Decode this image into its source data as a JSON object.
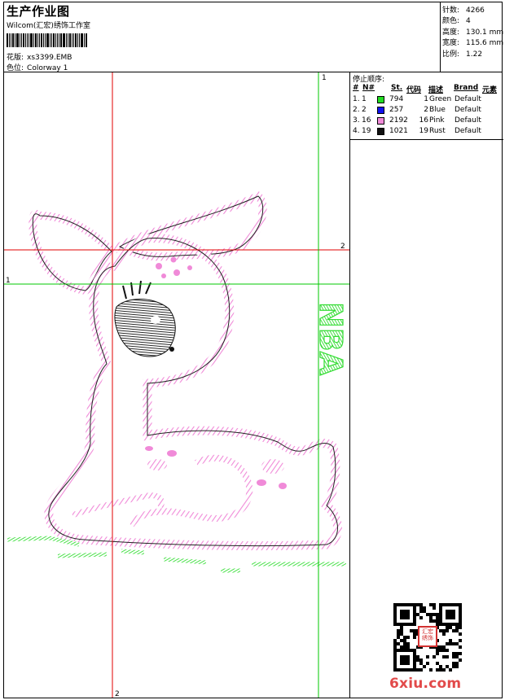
{
  "header": {
    "title": "生产作业图",
    "studio": "Wilcom(汇宏)绣饰工作室",
    "design_label": "花版:",
    "design_value": "xs3399.EMB",
    "colorway_label": "色位:",
    "colorway_value": "Colorway 1"
  },
  "stats": [
    {
      "label": "针数:",
      "value": "4266"
    },
    {
      "label": "颜色:",
      "value": "4"
    },
    {
      "label": "高度:",
      "value": "130.1 mm"
    },
    {
      "label": "宽度:",
      "value": "115.6 mm"
    },
    {
      "label": "比例:",
      "value": "1.22"
    }
  ],
  "stop_sequence": {
    "title": "停止顺序:",
    "columns": [
      "#",
      "N#",
      "St.",
      "代码",
      "描述",
      "Brand",
      "元素"
    ],
    "rows": [
      {
        "index": "1.",
        "needle": "1",
        "stitches": "794",
        "code": "1",
        "description": "Green",
        "brand": "Default",
        "color": "#22dd22"
      },
      {
        "index": "2.",
        "needle": "2",
        "stitches": "257",
        "code": "2",
        "description": "Blue",
        "brand": "Default",
        "color": "#1010ee"
      },
      {
        "index": "3.",
        "needle": "16",
        "stitches": "2192",
        "code": "16",
        "description": "Pink",
        "brand": "Default",
        "color": "#f08ad8"
      },
      {
        "index": "4.",
        "needle": "19",
        "stitches": "1021",
        "code": "19",
        "description": "Rust",
        "brand": "Default",
        "color": "#111111"
      }
    ]
  },
  "design_area": {
    "guide_labels": {
      "top_green": "1",
      "left_green": "1",
      "right_red": "2",
      "bottom_red": "2"
    },
    "embroidered_text": "NBA",
    "guide_colors": {
      "red": "#e00000",
      "green": "#00c800"
    },
    "thread_colors": {
      "outline": "#222222",
      "pink": "#f08ad8",
      "green": "#33dd33",
      "black": "#111111"
    }
  },
  "qr": {
    "seal_text": "汇宏\n绣饰"
  },
  "watermark": {
    "prefix": "6xiu",
    "suffix": ".com"
  }
}
